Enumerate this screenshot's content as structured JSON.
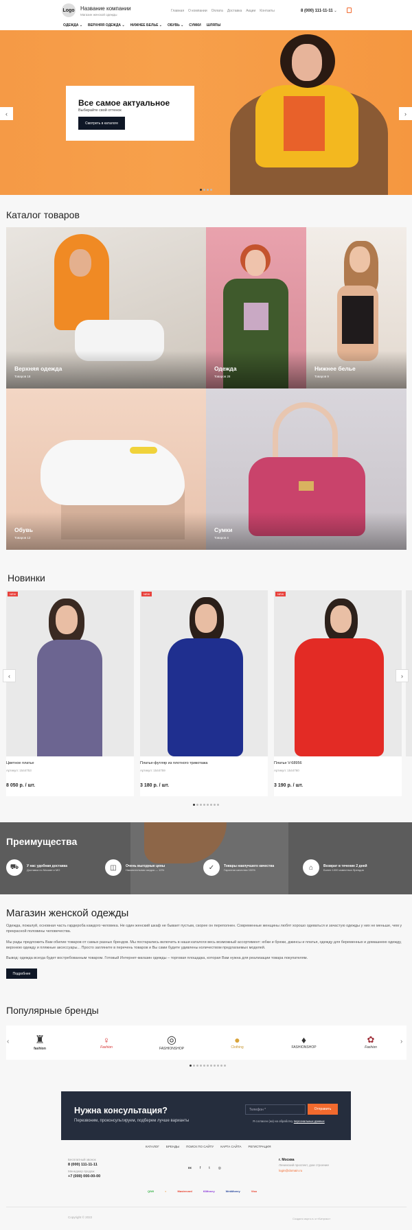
{
  "header": {
    "logo": "Logo",
    "company_name": "Название компании",
    "company_sub": "Магазин женской одежды",
    "top_nav": [
      "Главная",
      "О компании",
      "Оплата",
      "Доставка",
      "Акции",
      "Контакты"
    ],
    "phone": "8 (000) 111-11-11",
    "main_nav": [
      "ОДЕЖДА",
      "ВЕРХНЯЯ ОДЕЖДА",
      "НИЖНЕЕ БЕЛЬЕ",
      "ОБУВЬ",
      "СУМКИ",
      "ШЛЯПЫ"
    ]
  },
  "hero": {
    "title": "Все самое актуальное",
    "subtitle": "Выбирайте свой оттенок",
    "button": "Смотреть в каталоге",
    "slides": 4,
    "active_slide": 1
  },
  "catalog": {
    "title": "Каталог товаров",
    "tiles": [
      {
        "label": "Верхняя одежда",
        "count": "Товаров 18"
      },
      {
        "label": "Одежда",
        "count": "Товаров 28"
      },
      {
        "label": "Нижнее белье",
        "count": "Товаров 9"
      },
      {
        "label": "Обувь",
        "count": "Товаров 12"
      },
      {
        "label": "Сумки",
        "count": "Товаров 4"
      }
    ]
  },
  "new_items": {
    "title": "Новинки",
    "badge": "NEW",
    "products": [
      {
        "name": "Цветное платье",
        "article": "Артикул: 1544753",
        "price": "8 050 р. / шт."
      },
      {
        "name": "Платье-футляр из плотного трикотажа",
        "article": "Артикул: 1544759",
        "price": "3 180 р. / шт."
      },
      {
        "name": "Платье V-68956",
        "article": "Артикул: 1544760",
        "price": "3 190 р. / шт."
      }
    ],
    "pages": 8,
    "active_page": 1
  },
  "advantages": {
    "title": "Преимущества",
    "items": [
      {
        "title": "У нас удобная доставка",
        "sub": "Доставка по Москве и МО"
      },
      {
        "title": "Очень выгодные цены",
        "sub": "Накопительная скидка — 10%"
      },
      {
        "title": "Товары наилучшего качества",
        "sub": "Гарантия качества 100%"
      },
      {
        "title": "Возврат в течение 2 дней",
        "sub": "Более 1000 известных брендов"
      }
    ]
  },
  "about": {
    "title": "Магазин женской одежды",
    "p1": "Одежда, пожалуй, основная часть гардероба каждого человека. Не один женский шкаф не бывает пустым, скорее он переполнен. Современные женщины любят хорошо одеваться и зачастую одежды у них не меньше, чем у прекрасной половины человечества.",
    "p2": "Мы рады предложить Вам обилие товаров от самых разных брендов. Мы постарались включить в наши каталоги весь возможный ассортимент: юбки и брюки, джинсы и платья, одежду для беременных и домашнюю одежду, верхнюю одежду и пляжные аксессуары... Просто загляните в перечень товаров и Вы сами будете удивлены количеством предлагаемых моделей.",
    "p3": "Вывод: одежда всегда будет востребованным товаром. Готовый Интернет-магазин одежды – торговая площадка, которая Вам нужна для реализации товара покупателям.",
    "button": "Подробнее"
  },
  "brands": {
    "title": "Популярные бренды",
    "items": [
      "fashion",
      "Fashion",
      "FASHIONSHOP",
      "Clothing",
      "FASHIONSHOP",
      "Fashion"
    ],
    "pages": 11,
    "active_page": 1
  },
  "consult": {
    "title": "Нужна консультация?",
    "subtitle": "Перезвоним, проконсультируем, подберем лучше варианты",
    "input_placeholder": "Телефон *",
    "send": "Отправить",
    "agree_text": "Я согласен (на) на обработку",
    "agree_link": "персональных данных"
  },
  "footer": {
    "nav": [
      "КАТАЛОГ",
      "БРЕНДЫ",
      "ПОИСК ПО САЙТУ",
      "КАРТА САЙТА",
      "РЕГИСТРАЦИЯ"
    ],
    "free_call": "Бесплатный звонок",
    "phone1": "8 (000) 111-11-11",
    "sales_label": "Менеджер продаж",
    "phone2": "+7 (000) 000-00-00",
    "city": "г. Москва",
    "address": "Ленинский проспект, дом строение",
    "email": "login@domain.ru",
    "social": [
      "вк",
      "f",
      "t",
      "◎"
    ],
    "payments": [
      "QIWI",
      "◐",
      "Mastercard",
      "ЮMoney",
      "WebMoney",
      "Visa"
    ],
    "payment_colors": [
      "#3bb54a",
      "#f08a1d",
      "#e8412d",
      "#8c3bd9",
      "#2b4a9f",
      "#e8412d"
    ],
    "copyright": "Copyright © 2022",
    "developer": "Создано aspro.ru и «Битрикс»"
  },
  "colors": {
    "accent": "#f26a2e",
    "dark": "#0f1726",
    "hero": "#f7a04b",
    "badge": "#e8413c"
  }
}
